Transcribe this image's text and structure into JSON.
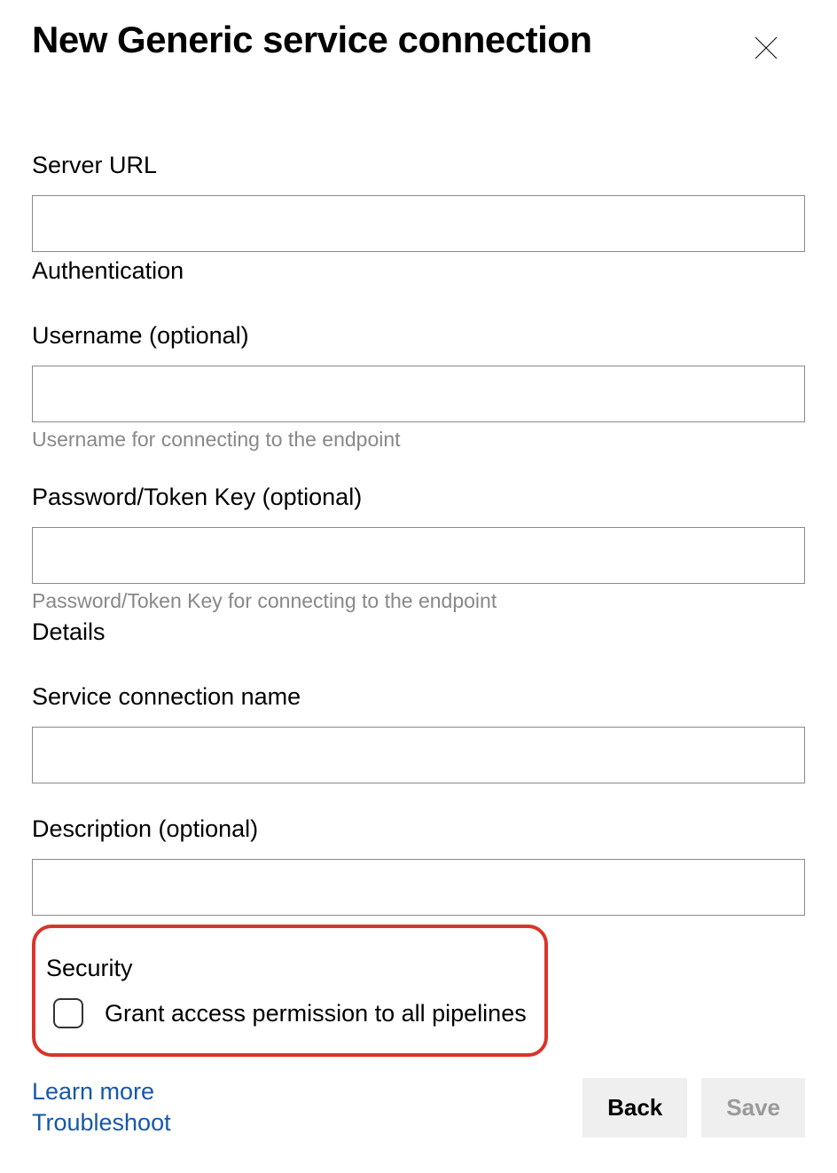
{
  "header": {
    "title": "New Generic service connection"
  },
  "fields": {
    "server_url": {
      "label": "Server URL",
      "value": ""
    },
    "authentication_heading": "Authentication",
    "username": {
      "label": "Username (optional)",
      "value": "",
      "help": "Username for connecting to the endpoint"
    },
    "password": {
      "label": "Password/Token Key (optional)",
      "value": "",
      "help": "Password/Token Key for connecting to the endpoint"
    },
    "details_heading": "Details",
    "connection_name": {
      "label": "Service connection name",
      "value": ""
    },
    "description": {
      "label": "Description (optional)",
      "value": ""
    }
  },
  "security": {
    "heading": "Security",
    "grant_label": "Grant access permission to all pipelines",
    "grant_checked": false
  },
  "footer": {
    "learn_more": "Learn more",
    "troubleshoot": "Troubleshoot",
    "back": "Back",
    "save": "Save"
  }
}
